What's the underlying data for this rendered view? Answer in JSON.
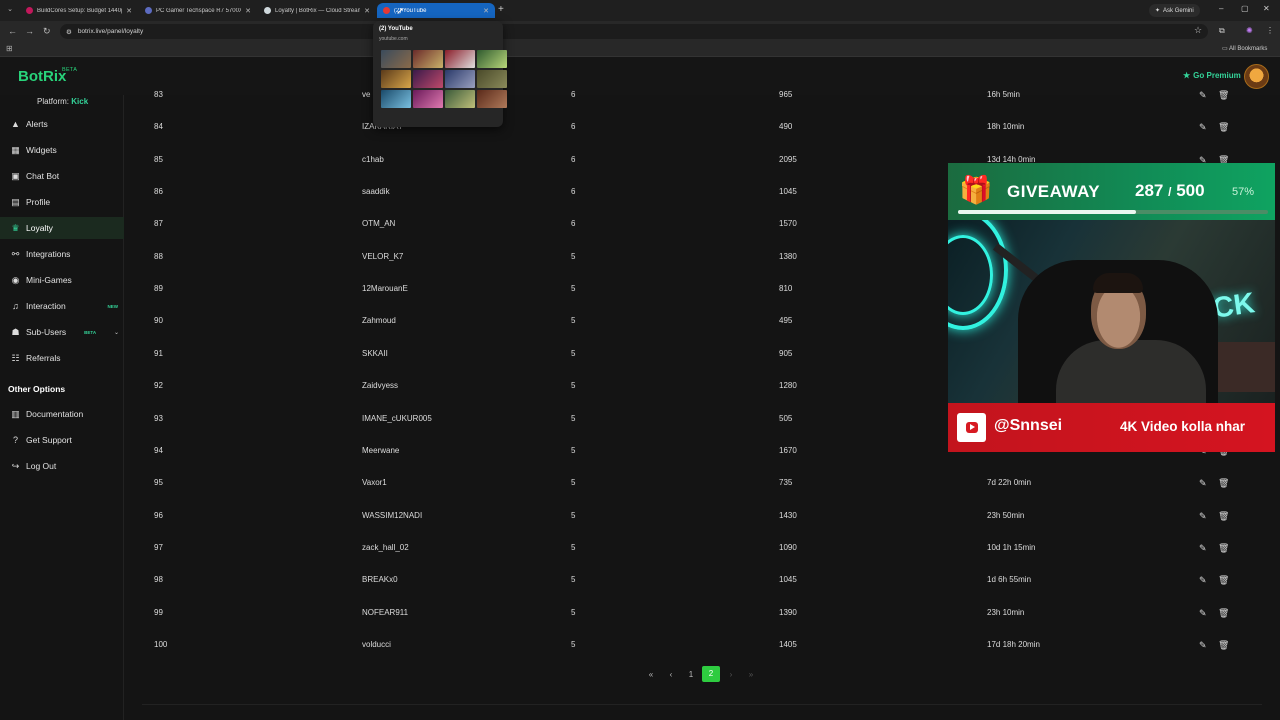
{
  "browser": {
    "tabs": [
      {
        "title": "BuildCores Setup: Budget 1440p",
        "favicon_color": "#c2185b",
        "active": false
      },
      {
        "title": "PC Gamer Techspace R7 5700X",
        "favicon_color": "#5c6bc0",
        "active": false
      },
      {
        "title": "Loyalty | BotRix — Cloud Stream",
        "favicon_color": "#cfd8dc",
        "active": false
      },
      {
        "title": "(2) YouTube",
        "favicon_color": "#e53935",
        "active": true
      }
    ],
    "new_tab": "+",
    "gemini_label": "Ask Gemini",
    "url": "botrix.live/panel/loyalty",
    "all_bookmarks": "All Bookmarks",
    "hover_card": {
      "title": "(2) YouTube",
      "host": "youtube.com"
    }
  },
  "header": {
    "logo": "BotRix",
    "logo_badge": "BETA",
    "premium_label": "Go Premium"
  },
  "sidebar": {
    "platform_label": "Platform:",
    "platform_value": "Kick",
    "items": [
      {
        "label": "Alerts",
        "icon": "warning-icon"
      },
      {
        "label": "Widgets",
        "icon": "grid-icon"
      },
      {
        "label": "Chat Bot",
        "icon": "chat-icon"
      },
      {
        "label": "Profile",
        "icon": "profile-icon"
      },
      {
        "label": "Loyalty",
        "icon": "trophy-icon",
        "active": true
      },
      {
        "label": "Integrations",
        "icon": "link-icon"
      },
      {
        "label": "Mini-Games",
        "icon": "gamepad-icon"
      },
      {
        "label": "Interaction",
        "icon": "music-icon",
        "badge": "NEW"
      },
      {
        "label": "Sub-Users",
        "icon": "users-icon",
        "badge": "BETA"
      },
      {
        "label": "Referrals",
        "icon": "referral-icon"
      }
    ],
    "other_title": "Other Options",
    "other_items": [
      {
        "label": "Documentation",
        "icon": "book-icon"
      },
      {
        "label": "Get Support",
        "icon": "help-icon"
      },
      {
        "label": "Log Out",
        "icon": "logout-icon"
      }
    ]
  },
  "table": {
    "rows": [
      {
        "rank": "83",
        "user": "ve",
        "level": "6",
        "points": "965",
        "time": "16h 5min"
      },
      {
        "rank": "84",
        "user": "IZAKARIA7",
        "level": "6",
        "points": "490",
        "time": "18h 10min"
      },
      {
        "rank": "85",
        "user": "c1hab",
        "level": "6",
        "points": "2095",
        "time": "13d 14h 0min"
      },
      {
        "rank": "86",
        "user": "saaddik",
        "level": "6",
        "points": "1045",
        "time": ""
      },
      {
        "rank": "87",
        "user": "OTM_AN",
        "level": "6",
        "points": "1570",
        "time": ""
      },
      {
        "rank": "88",
        "user": "VELOR_K7",
        "level": "5",
        "points": "1380",
        "time": ""
      },
      {
        "rank": "89",
        "user": "12MarouanE",
        "level": "5",
        "points": "810",
        "time": ""
      },
      {
        "rank": "90",
        "user": "Zahmoud",
        "level": "5",
        "points": "495",
        "time": ""
      },
      {
        "rank": "91",
        "user": "SKKAII",
        "level": "5",
        "points": "905",
        "time": ""
      },
      {
        "rank": "92",
        "user": "Zaidvyess",
        "level": "5",
        "points": "1280",
        "time": ""
      },
      {
        "rank": "93",
        "user": "IMANE_cUKUR005",
        "level": "5",
        "points": "505",
        "time": ""
      },
      {
        "rank": "94",
        "user": "Meerwane",
        "level": "5",
        "points": "1670",
        "time": ""
      },
      {
        "rank": "95",
        "user": "Vaxor1",
        "level": "5",
        "points": "735",
        "time": "7d 22h 0min"
      },
      {
        "rank": "96",
        "user": "WASSIM12NADI",
        "level": "5",
        "points": "1430",
        "time": "23h 50min"
      },
      {
        "rank": "97",
        "user": "zack_hall_02",
        "level": "5",
        "points": "1090",
        "time": "10d 1h 15min"
      },
      {
        "rank": "98",
        "user": "BREAKx0",
        "level": "5",
        "points": "1045",
        "time": "1d 6h 55min"
      },
      {
        "rank": "99",
        "user": "NOFEAR911",
        "level": "5",
        "points": "1390",
        "time": "23h 10min"
      },
      {
        "rank": "100",
        "user": "volducci",
        "level": "5",
        "points": "1405",
        "time": "17d 18h 20min"
      }
    ]
  },
  "pagination": {
    "first": "«",
    "prev": "‹",
    "page1": "1",
    "page2": "2",
    "next": "›",
    "last": "»"
  },
  "overlay": {
    "giveaway_title": "GIVEAWAY",
    "count_current": "287",
    "count_sep": "/",
    "count_total": "500",
    "percent_text": "57%",
    "progress": 0.574,
    "neon_sign": "KICK",
    "yt_handle": "@Snnsei",
    "promo": "4K Video kolla nhar"
  }
}
